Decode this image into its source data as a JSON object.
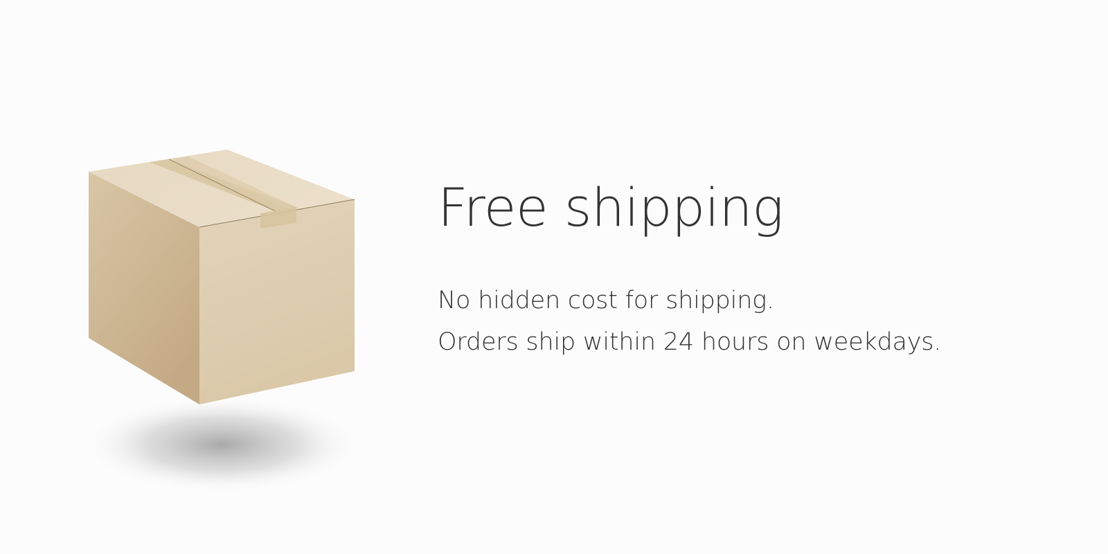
{
  "headline": "Free shipping",
  "description": {
    "line1": "No hidden cost for shipping.",
    "line2": "Orders ship within 24 hours on weekdays."
  },
  "illustration": {
    "icon": "cardboard-box-icon",
    "colors": {
      "box_light": "#ecdfca",
      "box_mid": "#dcc9a9",
      "box_dark": "#c8ae8a",
      "tape": "#d6c39e",
      "shadow": "#9a9a9a"
    }
  },
  "colors": {
    "background": "#fcfcfc",
    "text": "#333333"
  }
}
